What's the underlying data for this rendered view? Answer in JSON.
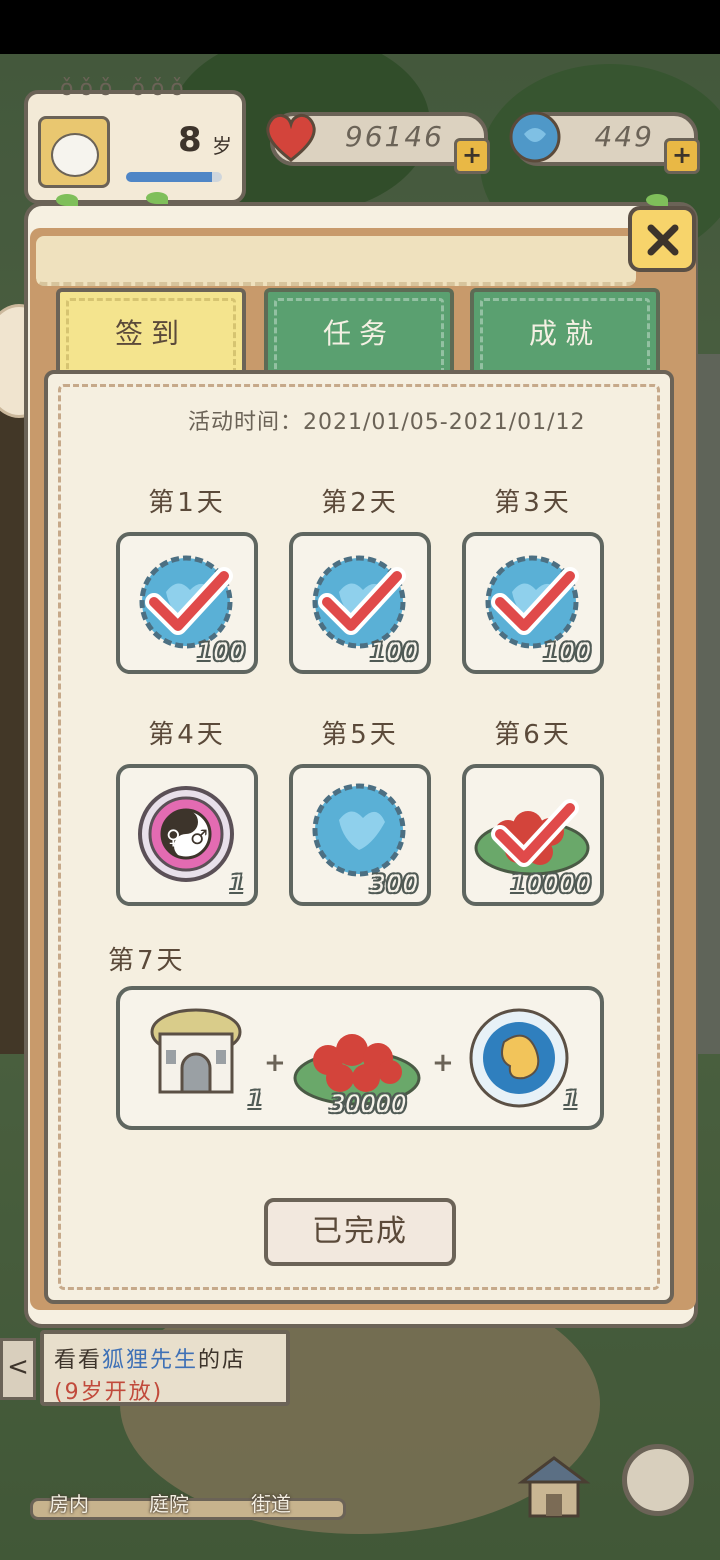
{
  "hud": {
    "age_value": "8",
    "age_unit": "岁",
    "age_progress": 0.9,
    "hearts": "96146",
    "clovers": "449",
    "plus": "+"
  },
  "modal": {
    "close_icon": "close-icon",
    "tabs": [
      {
        "label": "签到",
        "active": true
      },
      {
        "label": "任务",
        "active": false
      },
      {
        "label": "成就",
        "active": false
      }
    ],
    "event_time": "活动时间：2021/01/05-2021/01/12",
    "days": [
      {
        "label": "第1天",
        "reward": "clover",
        "qty": "100",
        "claimed": true
      },
      {
        "label": "第2天",
        "reward": "clover",
        "qty": "100",
        "claimed": true
      },
      {
        "label": "第3天",
        "reward": "clover",
        "qty": "100",
        "claimed": true
      },
      {
        "label": "第4天",
        "reward": "gender-token",
        "qty": "1",
        "claimed": false
      },
      {
        "label": "第5天",
        "reward": "clover",
        "qty": "300",
        "claimed": false
      },
      {
        "label": "第6天",
        "reward": "hearts",
        "qty": "10000",
        "claimed": true
      },
      {
        "label": "第7天",
        "rewards": [
          {
            "reward": "cottage",
            "qty": "1"
          },
          {
            "reward": "hearts",
            "qty": "30000"
          },
          {
            "reward": "embryo",
            "qty": "1"
          }
        ],
        "plus": "+"
      }
    ],
    "done_label": "已完成"
  },
  "background": {
    "shop_sign": {
      "line1_pre": "看看",
      "line1_name": "狐狸先生",
      "line1_post": "的店",
      "line2": "(9岁开放)"
    },
    "back_arrow": "<",
    "nav": [
      "房内",
      "庭院",
      "街道"
    ]
  },
  "colors": {
    "tab_active": "#f4e48e",
    "tab_inactive": "#5aa070",
    "accent_close": "#f7d46b",
    "check_red": "#e04a4a"
  }
}
